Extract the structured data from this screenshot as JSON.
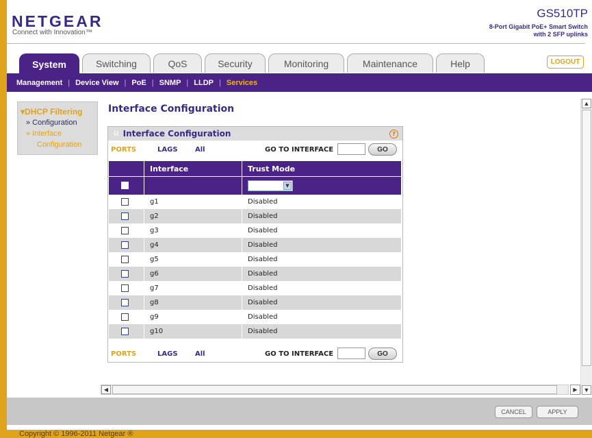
{
  "brand": {
    "logo": "NETGEAR",
    "tagline": "Connect with Innovation™"
  },
  "model": {
    "name": "GS510TP",
    "desc_line1": "8-Port Gigabit PoE+ Smart Switch",
    "desc_line2": "with 2 SFP uplinks"
  },
  "tabs": [
    {
      "label": "System",
      "active": true
    },
    {
      "label": "Switching",
      "active": false
    },
    {
      "label": "QoS",
      "active": false
    },
    {
      "label": "Security",
      "active": false
    },
    {
      "label": "Monitoring",
      "active": false
    },
    {
      "label": "Maintenance",
      "active": false
    },
    {
      "label": "Help",
      "active": false
    }
  ],
  "logout_label": "LOGOUT",
  "subnav": [
    {
      "label": "Management",
      "active": false
    },
    {
      "label": "Device View",
      "active": false
    },
    {
      "label": "PoE",
      "active": false
    },
    {
      "label": "SNMP",
      "active": false
    },
    {
      "label": "LLDP",
      "active": false
    },
    {
      "label": "Services",
      "active": true
    }
  ],
  "leftnav": {
    "header": "DHCP Filtering",
    "items": [
      "» Configuration",
      "» Interface",
      "Configuration"
    ]
  },
  "page_title": "Interface Configuration",
  "panel": {
    "title": "Interface Configuration",
    "help": "?",
    "filters": {
      "ports": "PORTS",
      "lags": "LAGS",
      "all": "All",
      "goto_label": "GO TO INTERFACE",
      "go_button": "GO",
      "goto_value": ""
    },
    "columns": [
      "Interface",
      "Trust Mode"
    ],
    "rows": [
      {
        "interface": "g1",
        "trust_mode": "Disabled"
      },
      {
        "interface": "g2",
        "trust_mode": "Disabled"
      },
      {
        "interface": "g3",
        "trust_mode": "Disabled"
      },
      {
        "interface": "g4",
        "trust_mode": "Disabled"
      },
      {
        "interface": "g5",
        "trust_mode": "Disabled"
      },
      {
        "interface": "g6",
        "trust_mode": "Disabled"
      },
      {
        "interface": "g7",
        "trust_mode": "Disabled"
      },
      {
        "interface": "g8",
        "trust_mode": "Disabled"
      },
      {
        "interface": "g9",
        "trust_mode": "Disabled"
      },
      {
        "interface": "g10",
        "trust_mode": "Disabled"
      }
    ]
  },
  "buttons": {
    "cancel": "CANCEL",
    "apply": "APPLY"
  },
  "copyright": "Copyright © 1996-2011 Netgear ®",
  "colors": {
    "brand_purple": "#4b2387",
    "accent_gold": "#e0a41c"
  }
}
